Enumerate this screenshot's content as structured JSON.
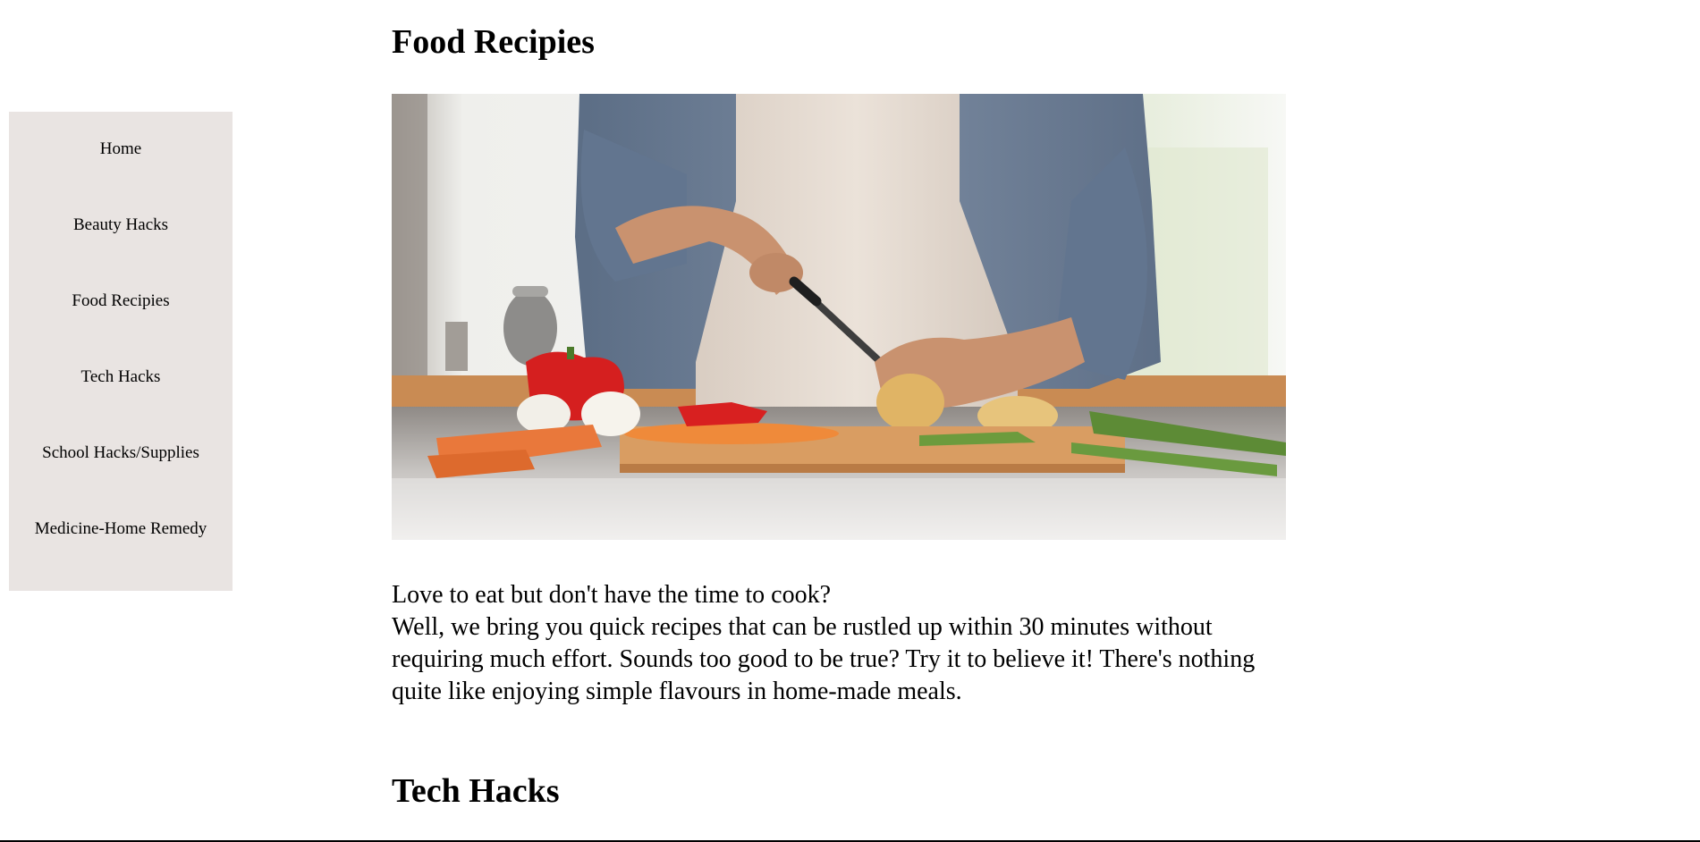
{
  "sidebar": {
    "items": [
      {
        "label": "Home"
      },
      {
        "label": "Beauty Hacks"
      },
      {
        "label": "Food Recipies"
      },
      {
        "label": "Tech Hacks"
      },
      {
        "label": "School Hacks/Supplies"
      },
      {
        "label": "Medicine-Home Remedy"
      }
    ]
  },
  "main": {
    "food_title": "Food Recipies",
    "food_paragraph": {
      "line1": "Love to eat but don't have the time to cook?",
      "line2": "Well, we bring you quick recipes that can be rustled up within 30 minutes without requiring much effort. Sounds too good to be true? Try it to believe it! There's nothing quite like enjoying simple flavours in home-made meals."
    },
    "tech_title": "Tech Hacks"
  },
  "colors": {
    "sidebar_bg": "#e9e4e2",
    "text": "#000000",
    "background": "#ffffff"
  }
}
